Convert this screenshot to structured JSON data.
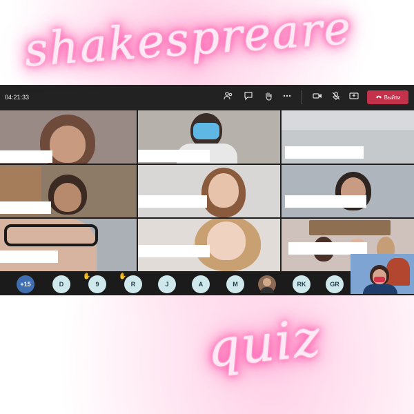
{
  "overlay": {
    "title": "shakespreare",
    "subtitle": "quiz"
  },
  "meeting": {
    "timer": "04:21:33",
    "toolbar_icons": [
      "participants-icon",
      "chat-icon",
      "raise-hand-icon",
      "more-icon",
      "camera-icon",
      "mic-muted-icon",
      "share-icon"
    ],
    "leave_label": "Выйти",
    "leave_color": "#c4314b"
  },
  "participants_bar": {
    "more_count": "+15",
    "avatars": [
      {
        "initials": "D",
        "hand": false
      },
      {
        "initials": "9",
        "hand": true
      },
      {
        "initials": "R",
        "hand": true
      },
      {
        "initials": "J",
        "hand": false
      },
      {
        "initials": "A",
        "hand": false
      },
      {
        "initials": "M",
        "hand": false
      },
      {
        "initials": "",
        "hand": false
      },
      {
        "initials": "RK",
        "hand": false
      },
      {
        "initials": "GR",
        "hand": false
      }
    ]
  },
  "colors": {
    "neon_pink": "#ff4fa8",
    "toolbar_bg": "#222222",
    "avatar_bg": "#cfe8ec"
  }
}
